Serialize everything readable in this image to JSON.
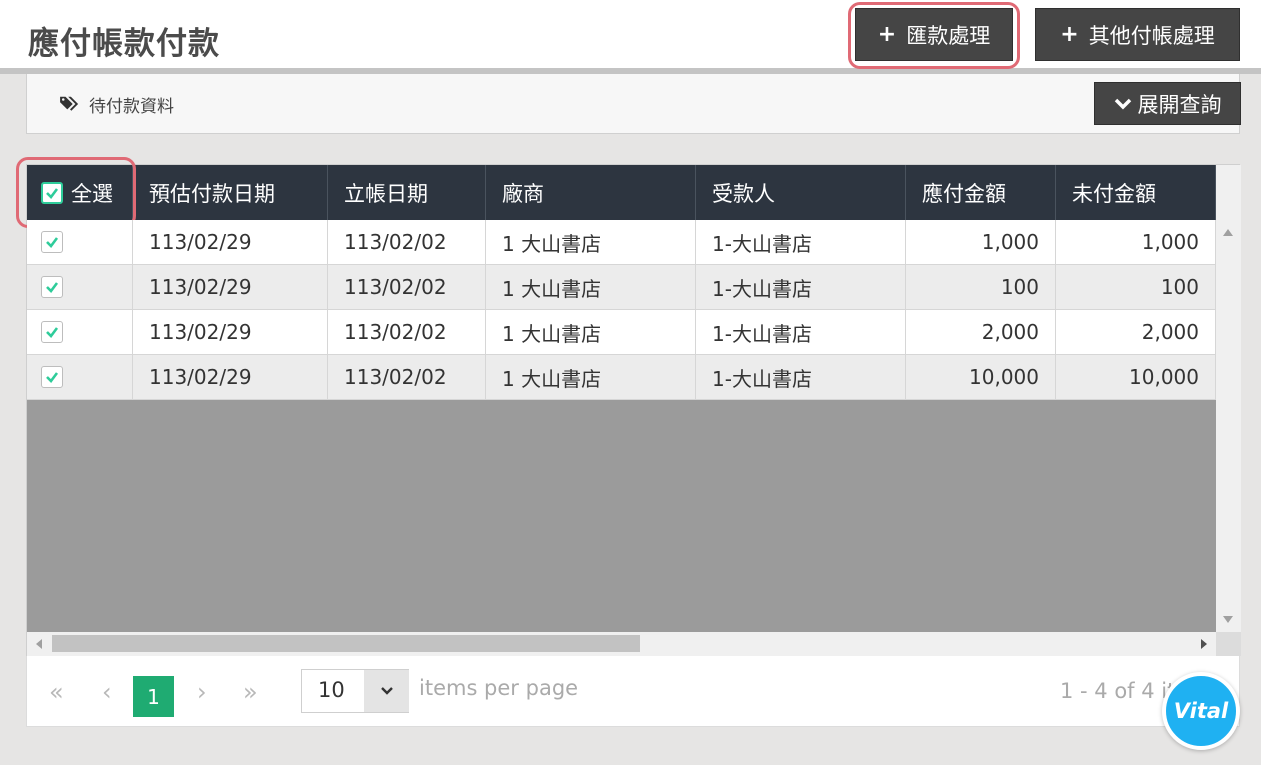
{
  "page": {
    "title": "應付帳款付款"
  },
  "toolbar": {
    "remit_label": "匯款處理",
    "other_label": "其他付帳處理",
    "plus_symbol": "+"
  },
  "info_panel": {
    "label": "待付款資料",
    "expand_label": "展開查詢",
    "tag_icon": "tag-icon",
    "expand_icon": "chevron-down-icon"
  },
  "grid": {
    "select_all_label": "全選",
    "columns": [
      "預估付款日期",
      "立帳日期",
      "廠商",
      "受款人",
      "應付金額",
      "未付金額"
    ],
    "rows": [
      {
        "checked": true,
        "est_pay_date": "113/02/29",
        "entry_date": "113/02/02",
        "vendor": "1 大山書店",
        "payee": "1-大山書店",
        "payable": "1,000",
        "unpaid": "1,000"
      },
      {
        "checked": true,
        "est_pay_date": "113/02/29",
        "entry_date": "113/02/02",
        "vendor": "1 大山書店",
        "payee": "1-大山書店",
        "payable": "100",
        "unpaid": "100"
      },
      {
        "checked": true,
        "est_pay_date": "113/02/29",
        "entry_date": "113/02/02",
        "vendor": "1 大山書店",
        "payee": "1-大山書店",
        "payable": "2,000",
        "unpaid": "2,000"
      },
      {
        "checked": true,
        "est_pay_date": "113/02/29",
        "entry_date": "113/02/02",
        "vendor": "1 大山書店",
        "payee": "1-大山書店",
        "payable": "10,000",
        "unpaid": "10,000"
      }
    ]
  },
  "pager": {
    "first": "«",
    "prev": "‹",
    "current_page": "1",
    "next": "›",
    "last": "»",
    "page_size": "10",
    "per_page_label": "items per page",
    "range_info": "1 - 4 of 4 items"
  },
  "badge": {
    "label": "Vital"
  },
  "colors": {
    "header_bg": "#2d3540",
    "button_bg": "#454545",
    "highlight": "#e06a75",
    "check": "#2ecc9a",
    "page_active": "#1fab72",
    "badge": "#1fb1f2"
  }
}
